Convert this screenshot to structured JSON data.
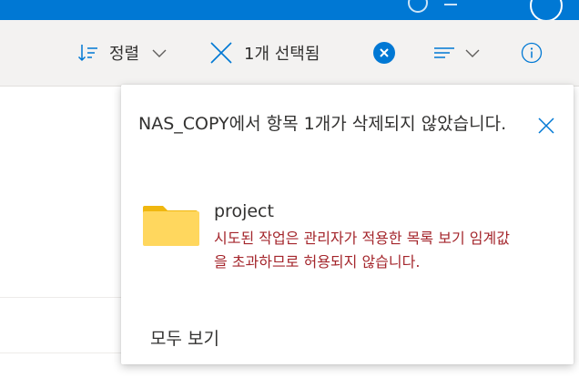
{
  "commandbar": {
    "sort_label": "정렬",
    "selection_label": "1개 선택됨"
  },
  "notification": {
    "title": "NAS_COPY에서 항목 1개가 삭제되지 않았습니다.",
    "item": {
      "name": "project",
      "error": "시도된 작업은 관리자가 적용한 목록 보기 임계값을 초과하므로 허용되지 않습니다."
    },
    "see_all_label": "모두 보기"
  },
  "colors": {
    "brand": "#0078d4",
    "error": "#a4262c",
    "folder": "#ffd75e"
  }
}
